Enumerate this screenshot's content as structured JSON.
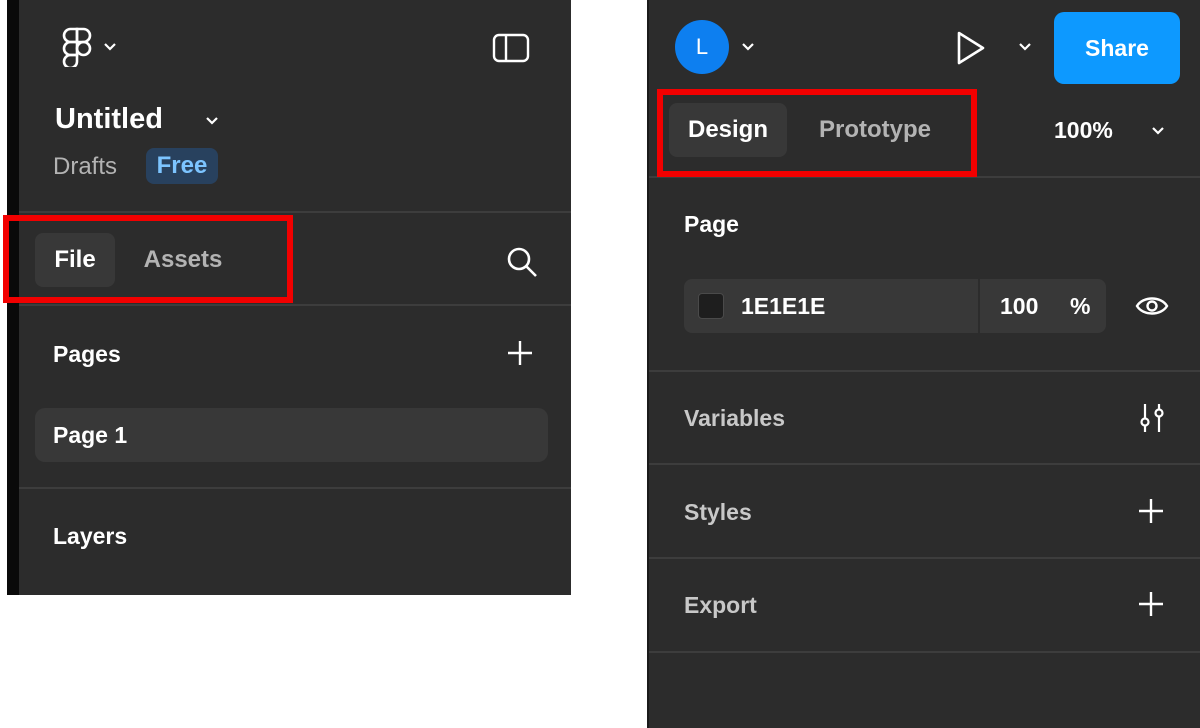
{
  "left_panel": {
    "file_title": "Untitled",
    "location": "Drafts",
    "plan_badge": "Free",
    "tabs": [
      {
        "label": "File",
        "active": true
      },
      {
        "label": "Assets",
        "active": false
      }
    ],
    "pages_heading": "Pages",
    "pages": [
      "Page 1"
    ],
    "layers_heading": "Layers"
  },
  "right_panel": {
    "avatar_initial": "L",
    "share_label": "Share",
    "tabs": [
      {
        "label": "Design",
        "active": true
      },
      {
        "label": "Prototype",
        "active": false
      }
    ],
    "zoom": "100%",
    "page_section": {
      "heading": "Page",
      "background_hex": "1E1E1E",
      "opacity": "100",
      "opacity_unit": "%"
    },
    "sections": [
      "Variables",
      "Styles",
      "Export"
    ]
  },
  "icons": {
    "logo": "figma-logo-icon",
    "sidebar_toggle": "sidebar-toggle-icon",
    "search": "search-icon",
    "add": "plus-icon",
    "play": "play-icon",
    "eye": "eye-icon",
    "variables": "sliders-icon",
    "chevron": "chevron-down-icon"
  },
  "colors": {
    "panel_bg": "#2c2c2c",
    "accent": "#0d99ff",
    "highlight": "#f20000",
    "badge_bg": "#28415e",
    "badge_text": "#7cc4ff"
  }
}
